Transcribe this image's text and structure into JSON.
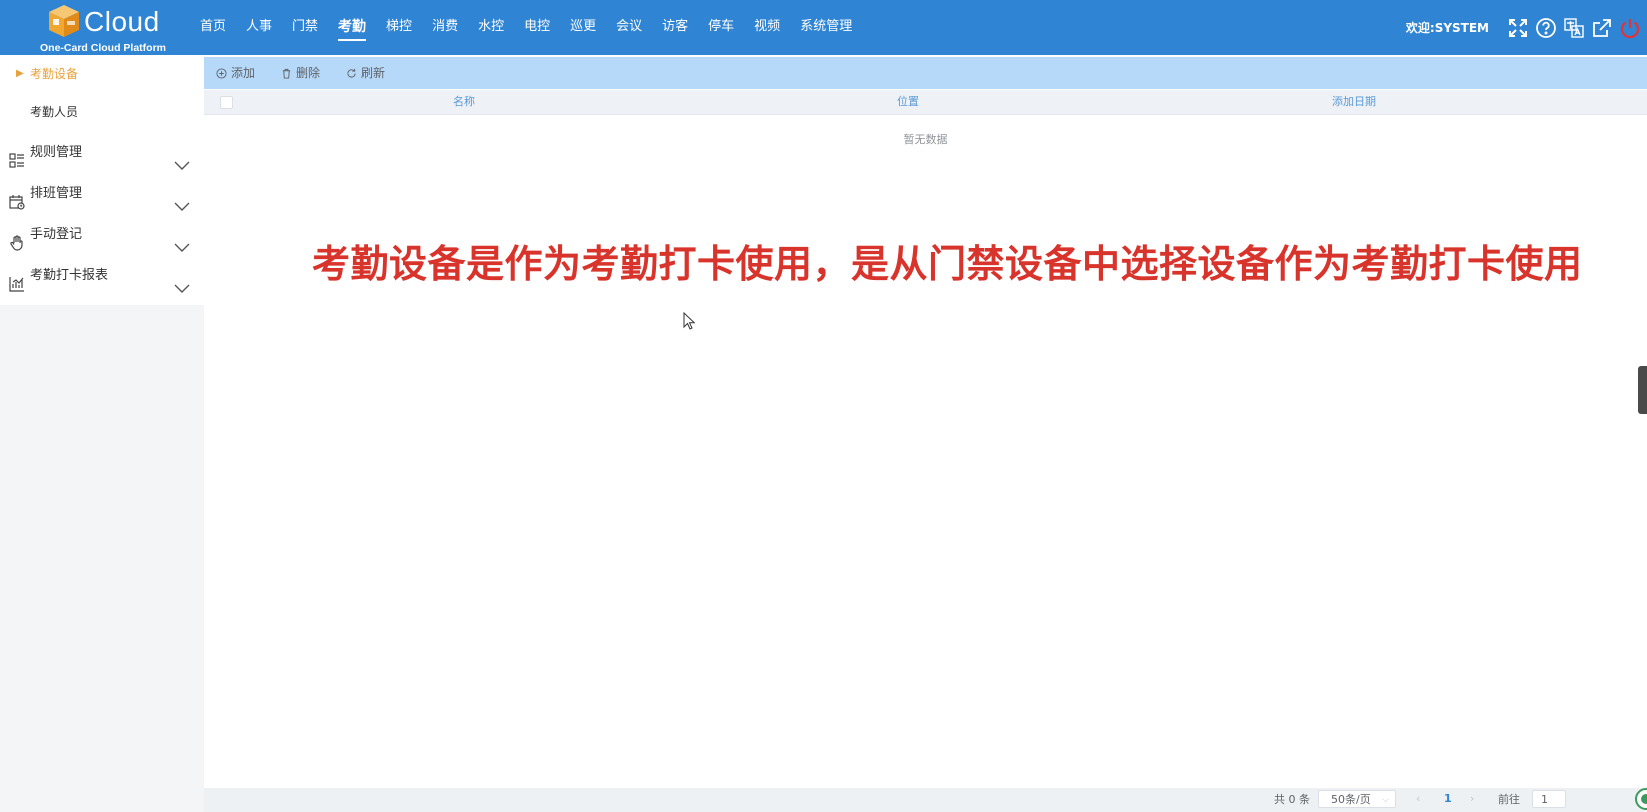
{
  "header": {
    "logo_text": "Cloud",
    "logo_subtitle": "One-Card Cloud Platform",
    "nav": [
      {
        "label": "首页",
        "active": false
      },
      {
        "label": "人事",
        "active": false
      },
      {
        "label": "门禁",
        "active": false
      },
      {
        "label": "考勤",
        "active": true
      },
      {
        "label": "梯控",
        "active": false
      },
      {
        "label": "消费",
        "active": false
      },
      {
        "label": "水控",
        "active": false
      },
      {
        "label": "电控",
        "active": false
      },
      {
        "label": "巡更",
        "active": false
      },
      {
        "label": "会议",
        "active": false
      },
      {
        "label": "访客",
        "active": false
      },
      {
        "label": "停车",
        "active": false
      },
      {
        "label": "视频",
        "active": false
      },
      {
        "label": "系统管理",
        "active": false
      }
    ],
    "welcome": "欢迎:SYSTEM",
    "icons": [
      "fullscreen-icon",
      "help-icon",
      "language-icon",
      "external-link-icon",
      "power-icon"
    ],
    "accent_color": "#2f84d4"
  },
  "sidebar": {
    "sub_items": [
      {
        "label": "考勤设备",
        "active": true
      },
      {
        "label": "考勤人员",
        "active": false
      }
    ],
    "groups": [
      {
        "label": "规则管理",
        "icon": "rules-icon"
      },
      {
        "label": "排班管理",
        "icon": "calendar-icon"
      },
      {
        "label": "手动登记",
        "icon": "hand-icon"
      },
      {
        "label": "考勤打卡报表",
        "icon": "report-chart-icon"
      }
    ],
    "active_color": "#e6a23c"
  },
  "toolbar": {
    "add_label": "添加",
    "delete_label": "删除",
    "refresh_label": "刷新"
  },
  "table": {
    "columns": [
      "名称",
      "位置",
      "添加日期"
    ],
    "empty_text": "暂无数据"
  },
  "overlay_caption": "考勤设备是作为考勤打卡使用，是从门禁设备中选择设备作为考勤打卡使用",
  "pagination": {
    "total": "共 0 条",
    "page_size": "50条/页",
    "current_page": "1",
    "goto_label": "前往",
    "goto_value": "1"
  }
}
